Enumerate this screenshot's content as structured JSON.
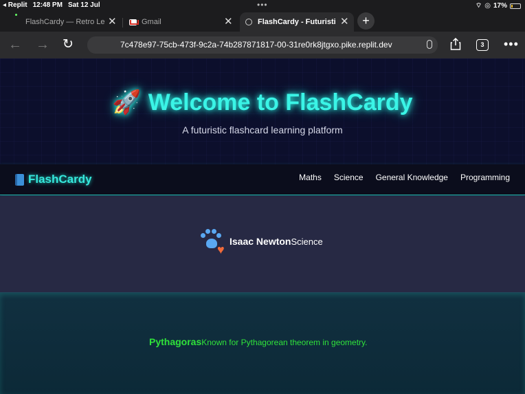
{
  "status_bar": {
    "back_app": "◂ Replit",
    "time": "12:48 PM",
    "date": "Sat 12 Jul",
    "battery": "17%",
    "battery_level": 0.17
  },
  "tabs": [
    {
      "title": "FlashCardy — Retro Lea",
      "active": false
    },
    {
      "title": "Gmail",
      "active": false
    },
    {
      "title": "FlashCardy - Futuristic",
      "active": true
    }
  ],
  "address_bar": {
    "url": "7c478e97-75cb-473f-9c2a-74b287871817-00-31re0rk8jtgxo.pike.replit.dev",
    "tab_count": "3"
  },
  "hero": {
    "rocket": "🚀",
    "title": "Welcome to FlashCardy",
    "subtitle": "A futuristic flashcard learning platform"
  },
  "navbar": {
    "brand": "FlashCardy",
    "links": [
      "Maths",
      "Science",
      "General Knowledge",
      "Programming"
    ]
  },
  "cards": [
    {
      "name": "Isaac Newton",
      "category": "Science"
    },
    {
      "name": "Pythagoras",
      "description": "Known for Pythagorean theorem in geometry."
    }
  ],
  "colors": {
    "accent_cyan": "#3af4e6",
    "green_text": "#2fe23a",
    "hero_bg": "#0c0f2c",
    "section_bg": "#272944"
  }
}
